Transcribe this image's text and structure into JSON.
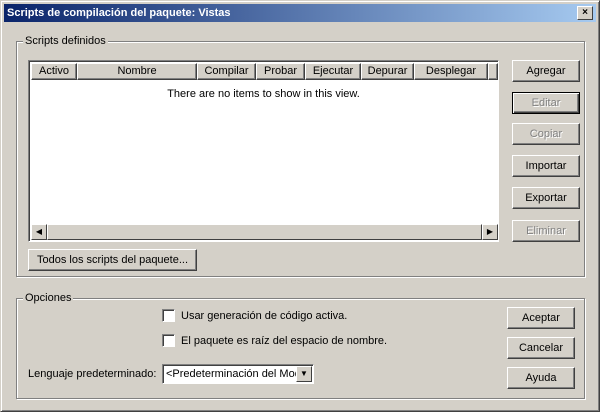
{
  "window": {
    "title": "Scripts de compilación del paquete: Vistas",
    "close_label": "×"
  },
  "scripts_group": {
    "label": "Scripts definidos",
    "columns": [
      "Activo",
      "Nombre",
      "Compilar",
      "Probar",
      "Ejecutar",
      "Depurar",
      "Desplegar"
    ],
    "empty_text": "There are no items to show in this view.",
    "all_scripts_button": "Todos los scripts del paquete..."
  },
  "side_buttons": {
    "add": "Agregar",
    "edit": "Editar",
    "copy": "Copiar",
    "import": "Importar",
    "export": "Exportar",
    "delete": "Eliminar"
  },
  "options_group": {
    "label": "Opciones",
    "active_codegen": "Usar generación de código activa.",
    "root_namespace": "El paquete es raíz del espacio de nombre.",
    "default_language_label": "Lenguaje predeterminado:",
    "default_language_value": "<Predeterminación del Modelo>"
  },
  "dialog_buttons": {
    "ok": "Aceptar",
    "cancel": "Cancelar",
    "help": "Ayuda"
  },
  "icons": {
    "scroll_left": "◀",
    "scroll_right": "▶",
    "dropdown": "▼"
  }
}
